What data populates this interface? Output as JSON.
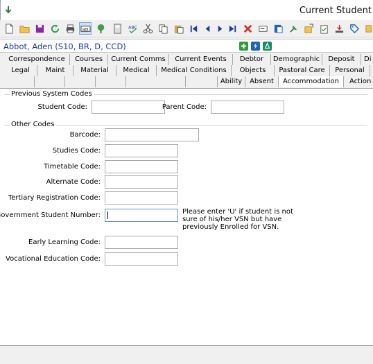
{
  "window": {
    "title": "Current Student"
  },
  "toolbar": {
    "icons": [
      "new-doc-icon",
      "open-folder-icon",
      "save-icon",
      "refresh-icon",
      "print-icon",
      "text-field-icon",
      "tree-icon",
      "calculator-icon",
      "spell-check-icon",
      "cut-icon",
      "copy-icon",
      "paste-icon",
      "first-record-icon",
      "previous-record-icon",
      "next-record-icon",
      "last-record-icon",
      "delete-icon",
      "card-icon",
      "document-icon",
      "pin-icon",
      "export-icon",
      "clipboard-check-icon",
      "download-icon",
      "tag-icon"
    ]
  },
  "student": {
    "name": "Abbot, Aden (S10, BR, D, CCD)"
  },
  "tabs": {
    "row1": [
      "Correspondence",
      "Courses",
      "Current Comms",
      "Current Events",
      "Debtor",
      "Demographic",
      "Deposit",
      "Di"
    ],
    "row2": [
      "Legal",
      "Maint",
      "Material",
      "Medical",
      "Medical Conditions",
      "Objects",
      "Pastoral Care",
      "Personal"
    ],
    "row3": [
      "",
      "",
      "",
      "",
      "",
      "",
      "Ability",
      "Absent",
      "Accommodation",
      "Action ("
    ]
  },
  "previous_codes": {
    "title": "Previous System Codes",
    "student_code_label": "Student Code:",
    "student_code_value": "",
    "parent_code_label": "Parent Code:",
    "parent_code_value": ""
  },
  "other_codes": {
    "title": "Other Codes",
    "barcode_label": "Barcode:",
    "barcode_value": "",
    "studies_label": "Studies Code:",
    "studies_value": "",
    "timetable_label": "Timetable Code:",
    "timetable_value": "",
    "alternate_label": "Alternate Code:",
    "alternate_value": "",
    "tertiary_label": "Tertiary Registration Code:",
    "tertiary_value": "",
    "gsn_label": "Government Student Number:",
    "gsn_value": "",
    "gsn_note": "Please enter 'U' if student is not sure of his/her VSN but have previously Enrolled for VSN.",
    "early_label": "Early Learning Code:",
    "early_value": "",
    "vocational_label": "Vocational Education Code:",
    "vocational_value": ""
  }
}
